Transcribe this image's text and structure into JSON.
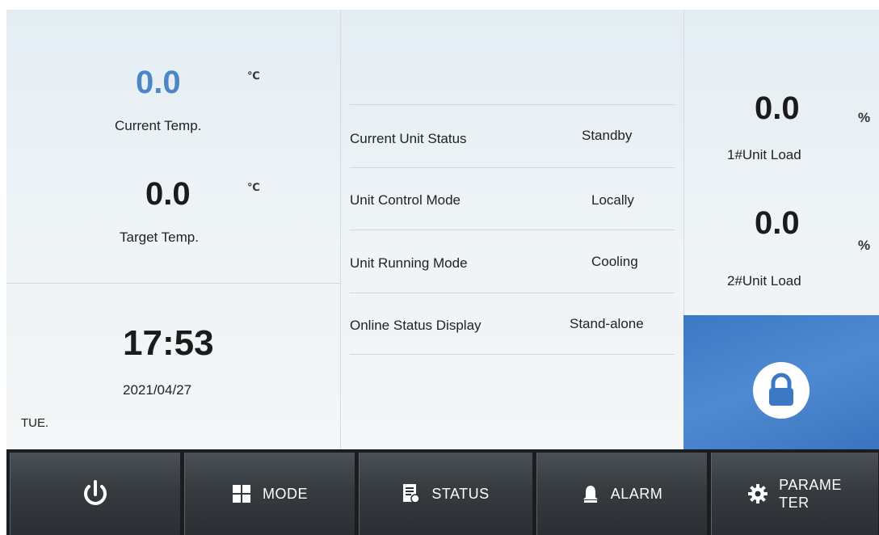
{
  "temps": {
    "current_value": "0.0",
    "current_unit": "℃",
    "current_label": "Current Temp.",
    "target_value": "0.0",
    "target_unit": "℃",
    "target_label": "Target Temp."
  },
  "clock": {
    "time": "17:53",
    "date": "2021/04/27",
    "weekday": "TUE."
  },
  "status": {
    "rows": [
      {
        "label": "Current Unit Status",
        "value": "Standby"
      },
      {
        "label": "Unit Control Mode",
        "value": "Locally"
      },
      {
        "label": "Unit Running Mode",
        "value": "Cooling"
      },
      {
        "label": "Online Status Display",
        "value": "Stand-alone"
      }
    ]
  },
  "loads": {
    "unit1_value": "0.0",
    "unit1_pct": "%",
    "unit1_label": "1#Unit Load",
    "unit2_value": "0.0",
    "unit2_pct": "%",
    "unit2_label": "2#Unit Load"
  },
  "lock": {
    "icon": "lock-icon"
  },
  "nav": {
    "power": {
      "icon": "power-icon"
    },
    "mode": {
      "label": "MODE",
      "icon": "grid-icon"
    },
    "status": {
      "label": "STATUS",
      "icon": "document-icon"
    },
    "alarm": {
      "label": "ALARM",
      "icon": "bell-icon"
    },
    "parameter": {
      "label_line1": "PARAME",
      "label_line2": "TER",
      "icon": "gear-icon"
    }
  },
  "colors": {
    "accent_blue": "#4a87c4",
    "lock_tile": "#3c78c4",
    "nav_bg": "#2b2f33"
  }
}
